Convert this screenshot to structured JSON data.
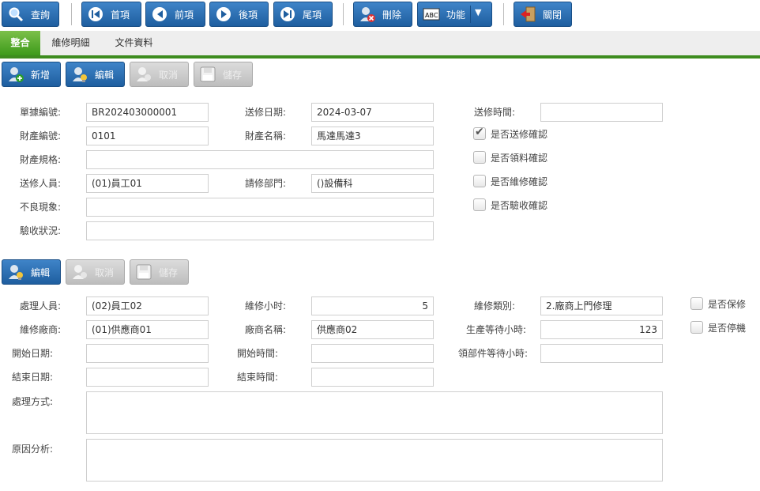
{
  "toolbar": {
    "query": "查詢",
    "first": "首項",
    "prev": "前項",
    "next": "後項",
    "last": "尾項",
    "delete": "刪除",
    "function": "功能",
    "close": "關閉"
  },
  "tabs": [
    "整合",
    "維修明細",
    "文件資料"
  ],
  "section1_actions": {
    "add": "新增",
    "edit": "編輯",
    "cancel": "取消",
    "save": "儲存"
  },
  "section2_actions": {
    "edit": "編輯",
    "cancel": "取消",
    "save": "儲存"
  },
  "form1": {
    "doc_no_label": "單據編號:",
    "doc_no": "BR202403000001",
    "send_date_label": "送修日期:",
    "send_date": "2024-03-07",
    "send_time_label": "送修時間:",
    "send_time": "",
    "asset_no_label": "財產編號:",
    "asset_no": "0101",
    "asset_name_label": "財產名稱:",
    "asset_name": "馬達馬達3",
    "asset_spec_label": "財產規格:",
    "asset_spec": "",
    "sender_label": "送修人員:",
    "sender": "(01)員工01",
    "dept_label": "請修部門:",
    "dept": "()設備科",
    "defect_label": "不良現象:",
    "defect": "",
    "acceptance_label": "驗收狀況:",
    "acceptance": "",
    "checks": [
      {
        "label": "是否送修確認",
        "checked": true
      },
      {
        "label": "是否領料確認",
        "checked": false
      },
      {
        "label": "是否維修確認",
        "checked": false
      },
      {
        "label": "是否驗收確認",
        "checked": false
      }
    ]
  },
  "form2": {
    "handler_label": "處理人員:",
    "handler": "(02)員工02",
    "hours_label": "維修小时:",
    "hours": "5",
    "category_label": "維修類別:",
    "category": "2.廠商上門修理",
    "vendor_label": "維修廠商:",
    "vendor": "(01)供應商01",
    "vendor_name_label": "廠商名稱:",
    "vendor_name": "供應商02",
    "prod_wait_label": "生產等待小時:",
    "prod_wait": "123",
    "start_date_label": "開始日期:",
    "start_date": "",
    "start_time_label": "開始時間:",
    "start_time": "",
    "parts_wait_label": "領部件等待小時:",
    "parts_wait": "",
    "end_date_label": "結束日期:",
    "end_date": "",
    "end_time_label": "結束時間:",
    "end_time": "",
    "method_label": "處理方式:",
    "method": "",
    "cause_label": "原因分析:",
    "cause": "",
    "checks": [
      {
        "label": "是否保修",
        "checked": false
      },
      {
        "label": "是否停機",
        "checked": false
      }
    ]
  }
}
